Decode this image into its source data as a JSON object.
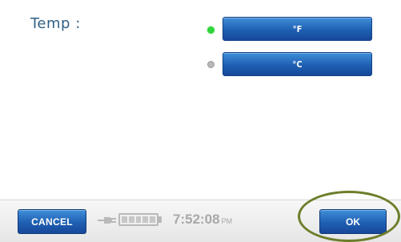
{
  "settings": {
    "label": "Temp :",
    "options": [
      {
        "label": "°F",
        "selected": true
      },
      {
        "label": "°C",
        "selected": false
      }
    ],
    "selected_color": "#2fd43a",
    "unselected_color": "#b8b8b8"
  },
  "footer": {
    "cancel_label": "CANCEL",
    "ok_label": "OK",
    "time": "7:52:08",
    "ampm": "PM",
    "battery_cells": 5
  },
  "theme": {
    "button_color": "#1f5fb2",
    "label_color": "#2f5f86",
    "highlight_color": "#6c7e2a"
  }
}
